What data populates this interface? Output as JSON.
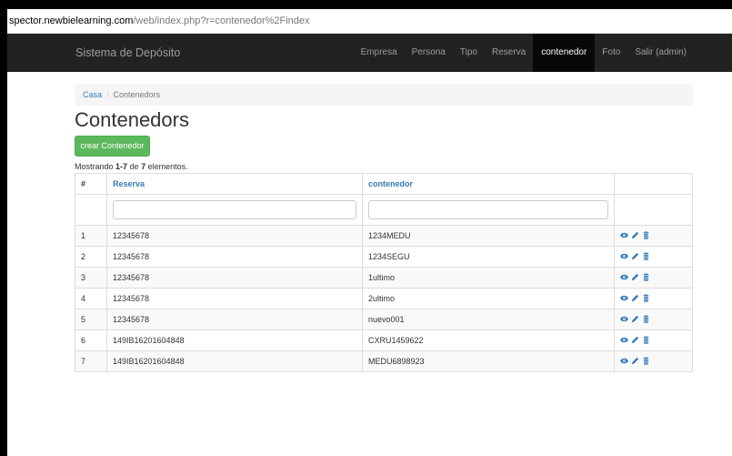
{
  "browser": {
    "url_host": "spector.newbielearning.com",
    "url_rest": "/web/index.php?r=contenedor%2Findex"
  },
  "navbar": {
    "brand": "Sistema de Depósito",
    "items": [
      {
        "label": "Empresa"
      },
      {
        "label": "Persona"
      },
      {
        "label": "Tipo"
      },
      {
        "label": "Reserva"
      },
      {
        "label": "contenedor",
        "active": true
      },
      {
        "label": "Foto"
      },
      {
        "label": "Salir (admin)"
      }
    ]
  },
  "breadcrumb": {
    "home": "Casa",
    "separator": "/",
    "current": "Contenedors"
  },
  "page": {
    "title": "Contenedors",
    "create_button": "crear Contenedor",
    "summary_prefix": "Mostrando ",
    "summary_range": "1-7",
    "summary_mid": " de ",
    "summary_total": "7",
    "summary_suffix": " elementos."
  },
  "table": {
    "headers": {
      "num": "#",
      "reserva": "Reserva",
      "contenedor": "contenedor"
    },
    "filters": {
      "reserva": "",
      "contenedor": ""
    },
    "rows": [
      {
        "num": "1",
        "reserva": "12345678",
        "contenedor": "1234MEDU"
      },
      {
        "num": "2",
        "reserva": "12345678",
        "contenedor": "1234SEGU"
      },
      {
        "num": "3",
        "reserva": "12345678",
        "contenedor": "1ultimo"
      },
      {
        "num": "4",
        "reserva": "12345678",
        "contenedor": "2ultimo"
      },
      {
        "num": "5",
        "reserva": "12345678",
        "contenedor": "nuevo001"
      },
      {
        "num": "6",
        "reserva": "149IB16201604848",
        "contenedor": "CXRU1459622"
      },
      {
        "num": "7",
        "reserva": "149IB16201604848",
        "contenedor": "MEDU6898923"
      }
    ],
    "action_icons": [
      "eye-icon",
      "pencil-icon",
      "trash-icon"
    ]
  },
  "colors": {
    "navbar_bg": "#222222",
    "link": "#337ab7",
    "success": "#5cb85c",
    "icon": "#337ab7"
  }
}
